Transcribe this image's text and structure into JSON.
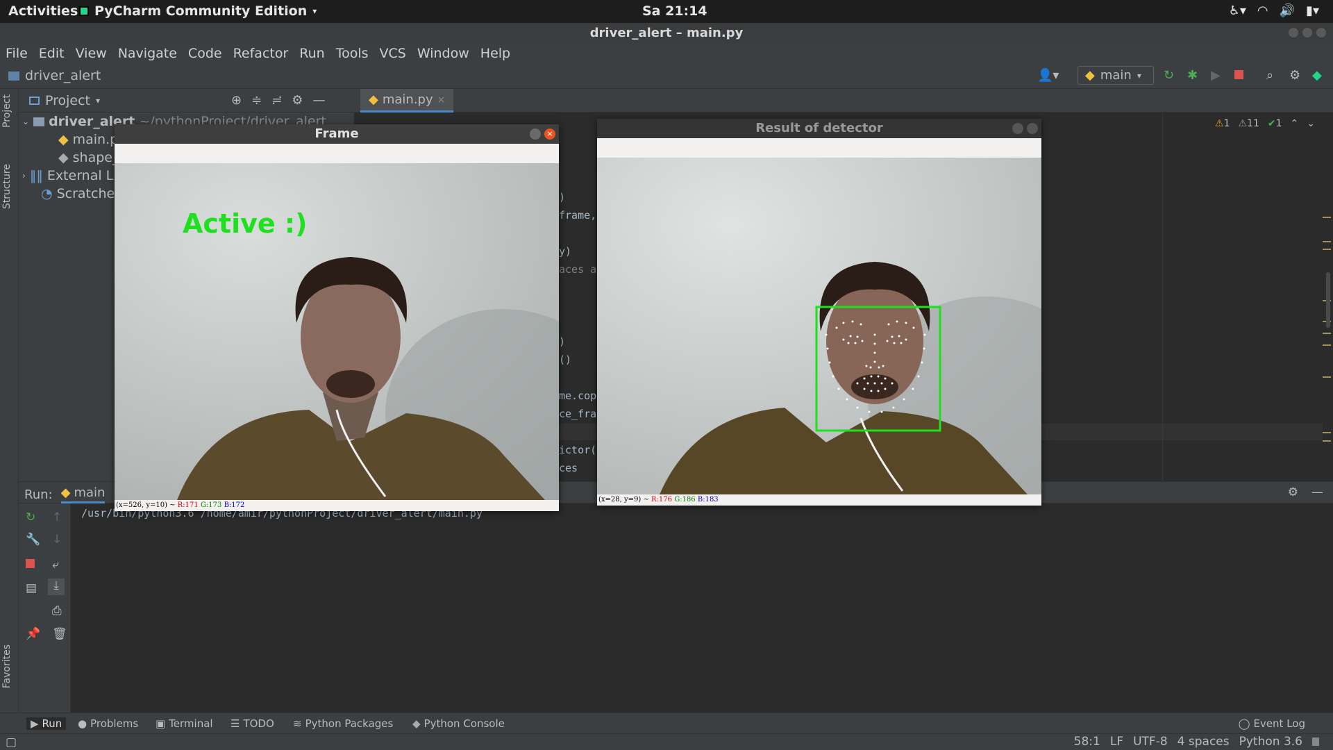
{
  "topbar": {
    "activities": "Activities",
    "app_name": "PyCharm Community Edition",
    "clock": "Sa 21:14"
  },
  "window": {
    "title": "driver_alert – main.py"
  },
  "menu": [
    "File",
    "Edit",
    "View",
    "Navigate",
    "Code",
    "Refactor",
    "Run",
    "Tools",
    "VCS",
    "Window",
    "Help"
  ],
  "navbar": {
    "project": "driver_alert",
    "run_config": "main"
  },
  "sidebar": {
    "project_tab": "Project",
    "structure_tab": "Structure",
    "favorites_tab": "Favorites"
  },
  "project_panel": {
    "title": "Project",
    "tree": [
      {
        "label": "driver_alert",
        "path": "~/pythonProject/driver_alert"
      },
      {
        "label": "main.p"
      },
      {
        "label": "shape_"
      },
      {
        "label": "External L"
      },
      {
        "label": "Scratches"
      }
    ]
  },
  "editor": {
    "tab": "main.py",
    "inspections": {
      "warnings": "1",
      "weak_warnings": "11",
      "ok": "1"
    },
    "code_fragments": [
      ")",
      "frame,",
      "y)",
      "aces a",
      ")",
      "()",
      "me.cop",
      "ce_fra",
      "ictor(",
      "ces"
    ]
  },
  "run_panel": {
    "label": "Run:",
    "config": "main",
    "console": "/usr/bin/python3.6 /home/amir/pythonProject/driver_alert/main.py"
  },
  "frame_window": {
    "title": "Frame",
    "overlay_text": "Active :)",
    "overlay_color": "#1fe01f",
    "status_prefix": "(x=526, y=10) ~ ",
    "r": "R:171",
    "g": "G:173",
    "b": "B:172"
  },
  "detector_window": {
    "title": "Result of detector",
    "box_color": "#1fe01f",
    "status_prefix": "(x=28, y=9) ~ ",
    "r": "R:176",
    "g": "G:186",
    "b": "B:183"
  },
  "bottom_tabs": [
    "Run",
    "Problems",
    "Terminal",
    "TODO",
    "Python Packages",
    "Python Console"
  ],
  "event_log": "Event Log",
  "status": {
    "position": "58:1",
    "line_sep": "LF",
    "encoding": "UTF-8",
    "indent": "4 spaces",
    "interpreter": "Python 3.6"
  }
}
